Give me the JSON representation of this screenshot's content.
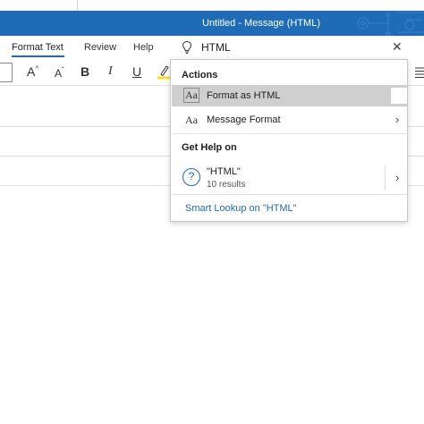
{
  "window": {
    "title": "Untitled  -  Message (HTML)"
  },
  "ribbon": {
    "tabs": [
      {
        "label": "Format Text",
        "active": true
      },
      {
        "label": "Review",
        "active": false
      },
      {
        "label": "Help",
        "active": false
      }
    ]
  },
  "search": {
    "value": "HTML",
    "icon": "lightbulb-icon",
    "clear_icon": "close-icon",
    "clear_glyph": "✕"
  },
  "toolbar": {
    "grow_font": "A",
    "grow_font_arrow": "^",
    "shrink_font": "A",
    "shrink_font_arrow": "ˇ",
    "bold": "B",
    "italic": "I",
    "underline": "U"
  },
  "dropdown": {
    "actions_header": "Actions",
    "actions": [
      {
        "icon": "Aa",
        "label": "Format as HTML",
        "selected": true
      },
      {
        "icon": "Aa",
        "label": "Message Format",
        "selected": false,
        "chevron": "›"
      }
    ],
    "help_header": "Get Help on",
    "help_item": {
      "icon": "?",
      "title": "\"HTML\"",
      "subtitle": "10 results",
      "chevron": "›"
    },
    "smart_lookup": "Smart Lookup on \"HTML\""
  },
  "colors": {
    "titlebar": "#1e6cb8",
    "accent": "#1e6cb8",
    "highlight": "#f4e61c"
  }
}
